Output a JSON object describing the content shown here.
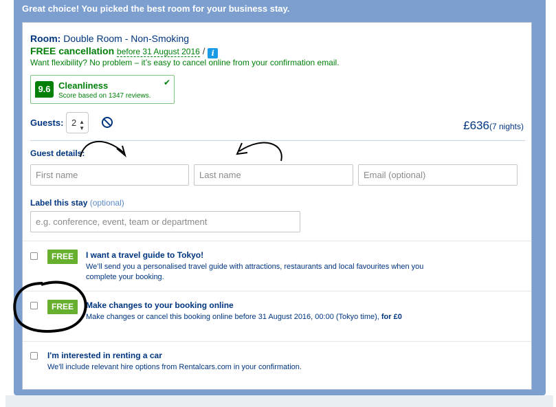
{
  "banner": "Great choice! You picked the best room for your business stay.",
  "room": {
    "label": "Room:",
    "name": "Double Room - Non-Smoking",
    "free_cancel": "FREE cancellation",
    "cancel_date": "before 31 August 2016",
    "slash": "/",
    "info_icon": "i",
    "flex_text": "Want flexibility? No problem – it’s easy to cancel online from your confirmation email."
  },
  "cleanliness": {
    "score": "9.6",
    "title": "Cleanliness",
    "sub": "Score based on 1347 reviews.",
    "check": "✔"
  },
  "guests": {
    "label": "Guests:",
    "value": "2",
    "arrows": "▲▼"
  },
  "price": {
    "amount": "£636",
    "nights": "(7 nights)"
  },
  "guest_details": {
    "label": "Guest details:",
    "first_placeholder": "First name",
    "last_placeholder": "Last name",
    "email_placeholder": "Email (optional)"
  },
  "label_stay": {
    "label": "Label this stay",
    "optional": "(optional)",
    "placeholder": "e.g. conference, event, team or department"
  },
  "options": [
    {
      "badge": "FREE",
      "title": "I want a travel guide to Tokyo!",
      "desc": "We’ll send you a personalised travel guide with attractions, restaurants and local favourites when you complete your booking."
    },
    {
      "badge": "FREE",
      "title": "Make changes to your booking online",
      "desc": "Make changes or cancel this booking online before 31 August 2016, 00:00 (Tokyo time),",
      "desc_bold": "for £0"
    },
    {
      "title": "I'm interested in renting a car",
      "desc": "We'll include relevant hire options from Rentalcars.com in your confirmation."
    }
  ],
  "colors": {
    "brand_blue": "#003580",
    "green": "#008009",
    "badge_green": "#67b02e",
    "frame_blue": "#7c9fcf"
  }
}
